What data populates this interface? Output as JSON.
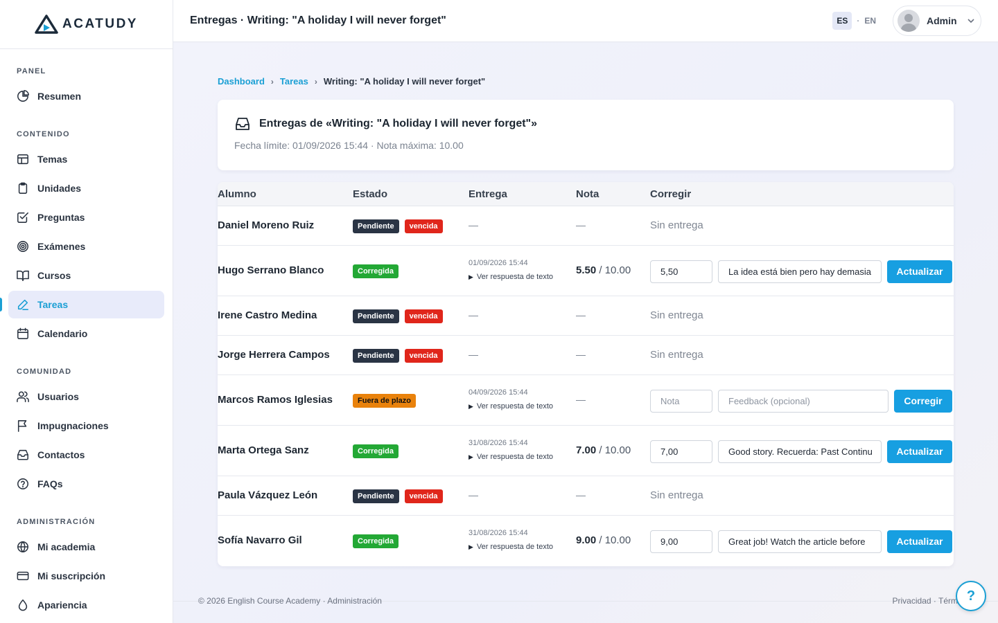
{
  "brand": {
    "name": "ACATUDY",
    "accent": "#1a9fd4"
  },
  "sidebar": {
    "sections": [
      {
        "heading": "PANEL",
        "items": [
          {
            "label": "Resumen",
            "icon": "pie-chart-icon"
          }
        ]
      },
      {
        "heading": "CONTENIDO",
        "items": [
          {
            "label": "Temas",
            "icon": "layout-icon"
          },
          {
            "label": "Unidades",
            "icon": "clipboard-icon"
          },
          {
            "label": "Preguntas",
            "icon": "check-square-icon"
          },
          {
            "label": "Exámenes",
            "icon": "target-icon"
          },
          {
            "label": "Cursos",
            "icon": "book-open-icon"
          },
          {
            "label": "Tareas",
            "icon": "pen-icon",
            "active": true
          },
          {
            "label": "Calendario",
            "icon": "calendar-icon"
          }
        ]
      },
      {
        "heading": "COMUNIDAD",
        "items": [
          {
            "label": "Usuarios",
            "icon": "users-icon"
          },
          {
            "label": "Impugnaciones",
            "icon": "flag-icon"
          },
          {
            "label": "Contactos",
            "icon": "inbox-icon"
          },
          {
            "label": "FAQs",
            "icon": "help-circle-icon"
          }
        ]
      },
      {
        "heading": "ADMINISTRACIÓN",
        "items": [
          {
            "label": "Mi academia",
            "icon": "globe-icon"
          },
          {
            "label": "Mi suscripción",
            "icon": "credit-card-icon"
          },
          {
            "label": "Apariencia",
            "icon": "droplet-icon"
          }
        ]
      }
    ]
  },
  "topbar": {
    "title": "Entregas · Writing: \"A holiday I will never forget\"",
    "lang_es": "ES",
    "lang_sep": "·",
    "lang_en": "EN",
    "user": "Admin"
  },
  "breadcrumb": {
    "items": [
      "Dashboard",
      "Tareas"
    ],
    "current": "Writing: \"A holiday I will never forget\""
  },
  "header_card": {
    "title": "Entregas de «Writing: \"A holiday I will never forget\"»",
    "subtitle": "Fecha límite: 01/09/2026 15:44 · Nota máxima: 10.00"
  },
  "table": {
    "columns": [
      "Alumno",
      "Estado",
      "Entrega",
      "Nota",
      "Corregir"
    ],
    "dash": "—",
    "no_delivery": "Sin entrega",
    "view_response": "Ver respuesta de texto",
    "max_grade": "/ 10.00",
    "rows": [
      {
        "name": "Daniel Moreno Ruiz",
        "badges": [
          "Pendiente",
          "vencida"
        ],
        "type": "pending"
      },
      {
        "name": "Hugo Serrano Blanco",
        "badges": [
          "Corregida"
        ],
        "type": "corrected",
        "date": "01/09/2026 15:44",
        "grade": "5.50",
        "grade_input": "5,50",
        "feedback": "La idea está bien pero hay demasia",
        "button": "Actualizar"
      },
      {
        "name": "Irene Castro Medina",
        "badges": [
          "Pendiente",
          "vencida"
        ],
        "type": "pending"
      },
      {
        "name": "Jorge Herrera Campos",
        "badges": [
          "Pendiente",
          "vencida"
        ],
        "type": "pending"
      },
      {
        "name": "Marcos Ramos Iglesias",
        "badges": [
          "Fuera de plazo"
        ],
        "type": "late",
        "date": "04/09/2026 15:44",
        "grade_placeholder": "Nota",
        "feedback_placeholder": "Feedback (opcional)",
        "button": "Corregir"
      },
      {
        "name": "Marta Ortega Sanz",
        "badges": [
          "Corregida"
        ],
        "type": "corrected",
        "date": "31/08/2026 15:44",
        "grade": "7.00",
        "grade_input": "7,00",
        "feedback": "Good story. Recuerda: Past Continu",
        "button": "Actualizar"
      },
      {
        "name": "Paula Vázquez León",
        "badges": [
          "Pendiente",
          "vencida"
        ],
        "type": "pending"
      },
      {
        "name": "Sofía Navarro Gil",
        "badges": [
          "Corregida"
        ],
        "type": "corrected",
        "date": "31/08/2026 15:44",
        "grade": "9.00",
        "grade_input": "9,00",
        "feedback": "Great job! Watch the article before",
        "button": "Actualizar"
      }
    ]
  },
  "footer": {
    "left": "© 2026 English Course Academy · Administración",
    "right": "Privacidad · Términos"
  },
  "help_button": "?"
}
